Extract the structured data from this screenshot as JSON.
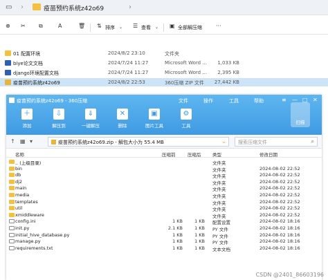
{
  "explorer": {
    "title": "疫苗预约系统z42o69",
    "toolbar": {
      "sort_label": "排序",
      "view_label": "查看",
      "select_all_label": "全部解压缩",
      "more_label": "···"
    },
    "files": [
      {
        "name": "01 配置环境",
        "date": "2024/8/2 23:10",
        "type": "文件夹",
        "size": "",
        "kind": "folder",
        "selected": false
      },
      {
        "name": "biye论文文档",
        "date": "2024/7/24 11:27",
        "type": "Microsoft Word ...",
        "size": "1,033 KB",
        "kind": "word",
        "selected": false
      },
      {
        "name": "django环境配置文档",
        "date": "2024/7/24 11:27",
        "type": "Microsoft Word ...",
        "size": "2,395 KB",
        "kind": "word",
        "selected": false
      },
      {
        "name": "疫苗预约系统z42o69",
        "date": "2024/8/2 22:53",
        "type": "360压缩 ZIP 文件",
        "size": "27,442 KB",
        "kind": "zip",
        "selected": true
      }
    ]
  },
  "zipwin": {
    "title": "疫苗预约系统z42o69 - 360压缩",
    "menu": [
      "文件",
      "操作",
      "工具",
      "帮助"
    ],
    "tools": [
      {
        "label": "添加",
        "icon": "add-icon"
      },
      {
        "label": "解压到",
        "icon": "extract-to-icon"
      },
      {
        "label": "一键解压",
        "icon": "one-click-extract-icon"
      },
      {
        "label": "删除",
        "icon": "delete-icon"
      },
      {
        "label": "图片工具",
        "icon": "image-tool-icon"
      },
      {
        "label": "工具",
        "icon": "tools-icon"
      }
    ],
    "scan_label": "扫描",
    "address": "疫苗预约系统z42o69.zip - 解包大小为 55.4 MB",
    "search_placeholder": "搜索压缩文件",
    "columns": {
      "name": "名称",
      "size": "压缩前",
      "csize": "压缩后",
      "type": "类型",
      "date": "修改日期"
    },
    "rows": [
      {
        "name": ".. (上级目录)",
        "size": "",
        "csize": "",
        "type": "文件夹",
        "date": "",
        "kind": "folder"
      },
      {
        "name": "bin",
        "size": "",
        "csize": "",
        "type": "文件夹",
        "date": "2024-08-02 22:52",
        "kind": "folder"
      },
      {
        "name": "db",
        "size": "",
        "csize": "",
        "type": "文件夹",
        "date": "2024-08-02 22:52",
        "kind": "folder"
      },
      {
        "name": "dj2",
        "size": "",
        "csize": "",
        "type": "文件夹",
        "date": "2024-08-02 22:52",
        "kind": "folder"
      },
      {
        "name": "main",
        "size": "",
        "csize": "",
        "type": "文件夹",
        "date": "2024-08-02 22:52",
        "kind": "folder"
      },
      {
        "name": "media",
        "size": "",
        "csize": "",
        "type": "文件夹",
        "date": "2024-08-02 22:52",
        "kind": "folder"
      },
      {
        "name": "templates",
        "size": "",
        "csize": "",
        "type": "文件夹",
        "date": "2024-08-02 22:52",
        "kind": "folder"
      },
      {
        "name": "util",
        "size": "",
        "csize": "",
        "type": "文件夹",
        "date": "2024-08-02 22:52",
        "kind": "folder"
      },
      {
        "name": "xmiddleware",
        "size": "",
        "csize": "",
        "type": "文件夹",
        "date": "2024-08-02 22:52",
        "kind": "folder"
      },
      {
        "name": "config.ini",
        "size": "1 KB",
        "csize": "1 KB",
        "type": "配置设置",
        "date": "2024-08-02 18:16",
        "kind": "file"
      },
      {
        "name": "init.py",
        "size": "2.1 KB",
        "csize": "1 KB",
        "type": "PY 文件",
        "date": "2024-08-02 18:16",
        "kind": "file"
      },
      {
        "name": "initial_hive_database.py",
        "size": "1 KB",
        "csize": "1 KB",
        "type": "PY 文件",
        "date": "2024-08-02 18:16",
        "kind": "file"
      },
      {
        "name": "manage.py",
        "size": "1 KB",
        "csize": "1 KB",
        "type": "PY 文件",
        "date": "2024-08-02 18:16",
        "kind": "file"
      },
      {
        "name": "requirements.txt",
        "size": "1 KB",
        "csize": "1 KB",
        "type": "文本文档",
        "date": "2024-08-02 18:16",
        "kind": "file"
      }
    ]
  },
  "watermark": "CSDN @2401_86603196",
  "colors": {
    "zip_header": "#4aa6e8",
    "folder": "#f5c13d",
    "selection": "#cde3f7"
  }
}
